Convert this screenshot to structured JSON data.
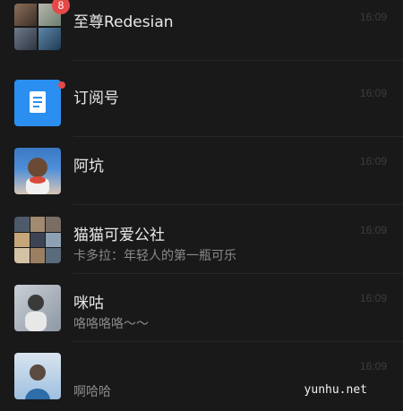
{
  "chats": [
    {
      "title": "至尊Redesian",
      "subtitle": "",
      "time": "16:09",
      "badge": "8"
    },
    {
      "title": "订阅号",
      "subtitle": "",
      "time": "16:09",
      "badge": ""
    },
    {
      "title": "阿坑",
      "subtitle": "",
      "time": "16:09",
      "badge": ""
    },
    {
      "title": "猫猫可爱公社",
      "subtitle": "卡多拉：年轻人的第一瓶可乐",
      "time": "16:09",
      "badge": ""
    },
    {
      "title": "咪咕",
      "subtitle": "咯咯咯咯～～",
      "time": "16:09",
      "badge": ""
    },
    {
      "title": "",
      "subtitle": "啊哈哈",
      "time": "16:09",
      "badge": ""
    }
  ],
  "watermark": "yunhu.net",
  "icons": {
    "subscription": "document-icon",
    "unread_dot": "unread-dot"
  },
  "colors": {
    "background": "#191919",
    "badge": "#e54848",
    "subscription_tile": "#2a8ff0"
  }
}
